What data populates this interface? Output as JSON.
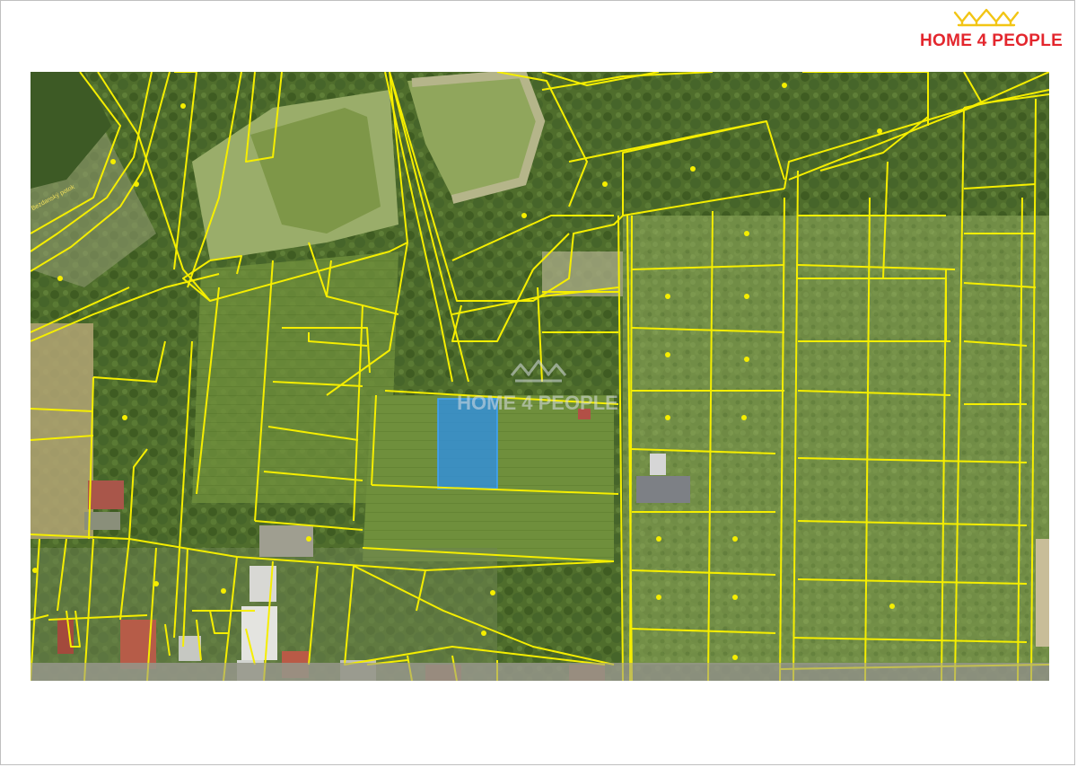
{
  "brand": {
    "name": "HOME 4 PEOPLE",
    "logo_icon": "house-crown-icon",
    "color": "#e3262d",
    "crown_color": "#f2c514"
  },
  "watermark": {
    "text": "HOME 4 PEOPLE",
    "icon": "house-crown-icon"
  },
  "map": {
    "style": "aerial cadastral map",
    "parcel_outline_color": "#f5ee00",
    "highlight_parcel_color": "#2e8fe6",
    "street_label": "Bezdanský potok"
  }
}
